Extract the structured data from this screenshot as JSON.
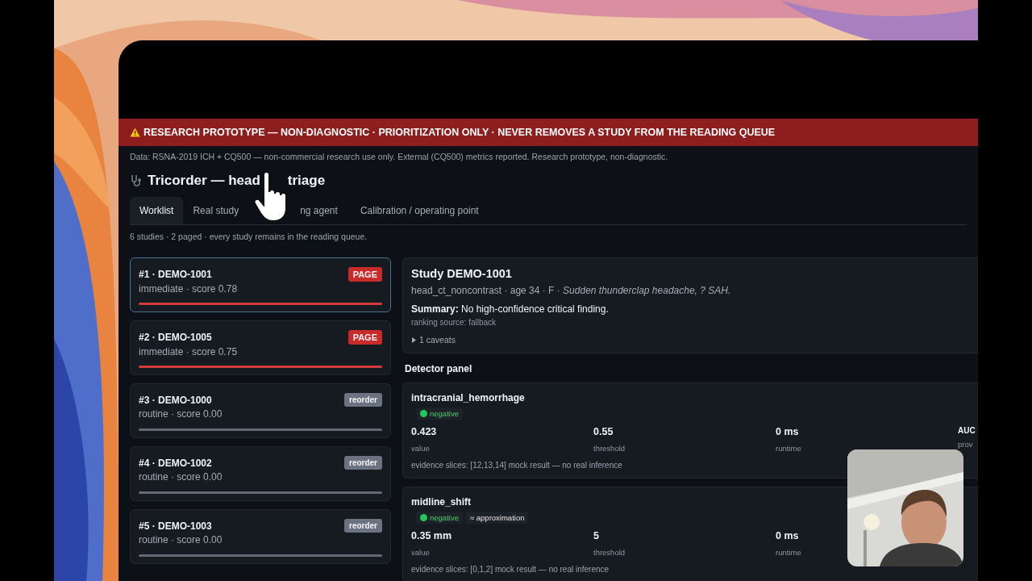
{
  "banner": {
    "text": "RESEARCH PROTOTYPE — NON-DIAGNOSTIC · PRIORITIZATION ONLY · NEVER REMOVES A STUDY FROM THE READING QUEUE"
  },
  "data_notice": "Data: RSNA-2019 ICH + CQ500 — non-commercial research use only. External (CQ500) metrics reported. Research prototype, non-diagnostic.",
  "title": {
    "start": "Tricorder — head",
    "end": "triage"
  },
  "tabs": [
    {
      "label": "Worklist",
      "selected": true
    },
    {
      "label": "Real study",
      "selected": false
    },
    {
      "label": "ng agent",
      "selected": false
    },
    {
      "label": "Calibration / operating point",
      "selected": false
    }
  ],
  "queue_summary": "6 studies · 2 paged · every study remains in the reading queue.",
  "worklist": [
    {
      "title": "#1 · DEMO-1001",
      "subtitle": "immediate · score 0.78",
      "badge": "PAGE",
      "kind": "page",
      "selected": true
    },
    {
      "title": "#2 · DEMO-1005",
      "subtitle": "immediate · score 0.75",
      "badge": "PAGE",
      "kind": "page",
      "selected": false
    },
    {
      "title": "#3 · DEMO-1000",
      "subtitle": "routine · score 0.00",
      "badge": "reorder",
      "kind": "reorder",
      "selected": false
    },
    {
      "title": "#4 · DEMO-1002",
      "subtitle": "routine · score 0.00",
      "badge": "reorder",
      "kind": "reorder",
      "selected": false
    },
    {
      "title": "#5 · DEMO-1003",
      "subtitle": "routine · score 0.00",
      "badge": "reorder",
      "kind": "reorder",
      "selected": false
    }
  ],
  "study": {
    "title": "Study DEMO-1001",
    "meta": "head_ct_noncontrast · age 34 · F · ",
    "indication": "Sudden thunderclap headache, ? SAH.",
    "summary": "**Summary:** No high-confidence critical finding.",
    "ranking_source": "ranking source: fallback",
    "caveats": {
      "label": "1 caveats",
      "expanded": false
    }
  },
  "detector_panel": {
    "heading": "Detector panel",
    "detectors": [
      {
        "name": "intracranial_hemorrhage",
        "tags": [
          {
            "kind": "status",
            "label": "negative",
            "color": "#22c55e"
          }
        ],
        "metrics": [
          {
            "value": "0.423",
            "label": "value"
          },
          {
            "value": "0.55",
            "label": "threshold"
          },
          {
            "value": "0 ms",
            "label": "runtime"
          },
          {
            "value": "AUC",
            "label": "prov"
          }
        ],
        "evidence": "evidence slices: [12,13,14] mock result — no real inference"
      },
      {
        "name": "midline_shift",
        "tags": [
          {
            "kind": "status",
            "label": "negative",
            "color": "#22c55e"
          },
          {
            "kind": "note",
            "label": "≈ approximation"
          }
        ],
        "metrics": [
          {
            "value": "0.35 mm",
            "label": "value"
          },
          {
            "value": "5",
            "label": "threshold"
          },
          {
            "value": "0 ms",
            "label": "runtime"
          }
        ],
        "evidence": "evidence slices: [0,1,2] mock result — no real inference"
      }
    ]
  }
}
